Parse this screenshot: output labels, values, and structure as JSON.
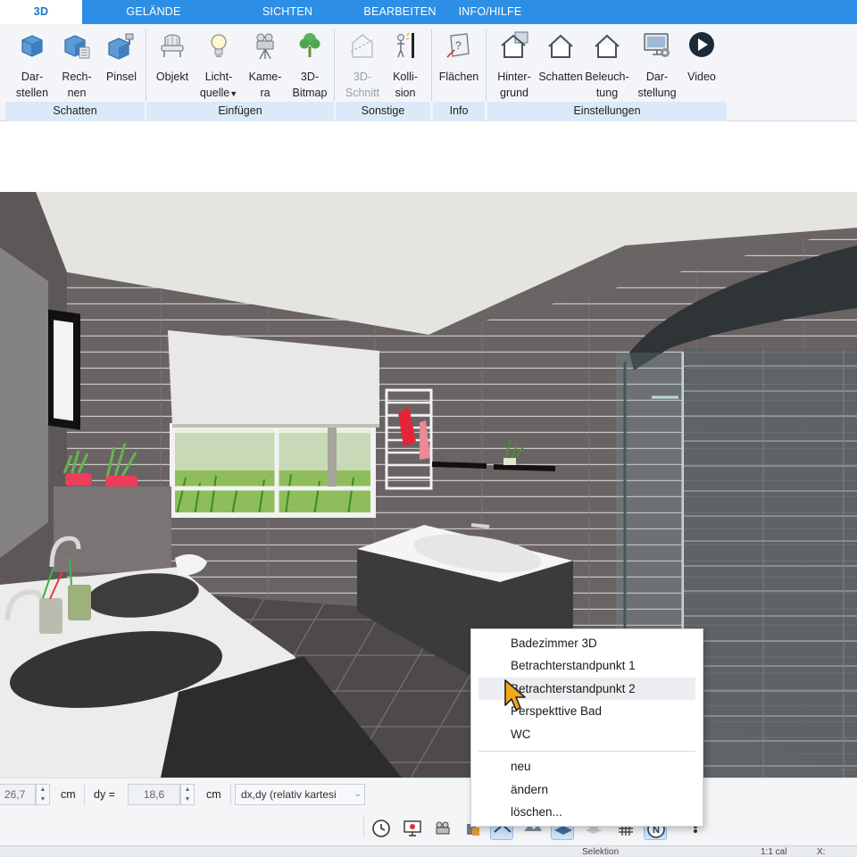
{
  "tabs": [
    {
      "label": "3D",
      "active": true
    },
    {
      "label": "GELÄNDE"
    },
    {
      "label": "SICHTEN"
    },
    {
      "label": "BEARBEITEN"
    },
    {
      "label": "INFO/HILFE"
    }
  ],
  "ribbon": {
    "groups": [
      {
        "label": "Schatten",
        "buttons": [
          {
            "label": "Dar-\nstellen",
            "icon": "cube-icon"
          },
          {
            "label": "Rech-\nnen",
            "icon": "cube-calc-icon"
          },
          {
            "label": "Pinsel",
            "icon": "cube-brush-icon"
          }
        ]
      },
      {
        "label": "Einfügen",
        "buttons": [
          {
            "label": "Objekt",
            "icon": "armchair-icon"
          },
          {
            "label": "Licht-\nquelle",
            "icon": "lightbulb-icon"
          },
          {
            "label": "Kame-\nra",
            "icon": "camera-icon"
          },
          {
            "label": "3D-\nBitmap",
            "icon": "tree-icon"
          }
        ]
      },
      {
        "label": "Sonstige",
        "buttons": [
          {
            "label": "3D-\nSchnitt",
            "icon": "section-icon",
            "disabled": true
          },
          {
            "label": "Kolli-\nsion",
            "icon": "collision-icon"
          }
        ]
      },
      {
        "label": "Info",
        "buttons": [
          {
            "label": "Flächen",
            "icon": "area-icon"
          }
        ]
      },
      {
        "label": "Einstellungen",
        "buttons": [
          {
            "label": "Hinter-\ngrund",
            "icon": "house-background-icon"
          },
          {
            "label": "Schatten",
            "icon": "house-shadow-icon"
          },
          {
            "label": "Beleuch-\ntung",
            "icon": "house-light-icon"
          },
          {
            "label": "Dar-\nstellung",
            "icon": "display-settings-icon"
          },
          {
            "label": "Video",
            "icon": "play-icon"
          }
        ]
      }
    ]
  },
  "coords": {
    "dx_value": "26,7",
    "unit1": "cm",
    "dy_label": "dy =",
    "dy_value": "18,6",
    "unit2": "cm",
    "mode": "dx,dy (relativ kartesi"
  },
  "context_menu": {
    "items": [
      "Badezimmer 3D",
      "Betrachterstandpunkt 1",
      "Betrachterstandpunkt 2",
      "Perspekttive Bad",
      "WC"
    ],
    "actions": [
      "neu",
      "ändern",
      "löschen..."
    ],
    "hovered": "Betrachterstandpunkt 2"
  },
  "status": {
    "selection": "Selektion",
    "scale": "1:1 cal",
    "x_label": "X:"
  },
  "colors": {
    "ribbon_tab": "#2c8fe5",
    "group_label_bg": "#dce9f8",
    "tile_wall": "#6b6465",
    "ceiling": "#e4e4e0",
    "floor": "#555253",
    "menu_hover": "#ebedf0"
  }
}
